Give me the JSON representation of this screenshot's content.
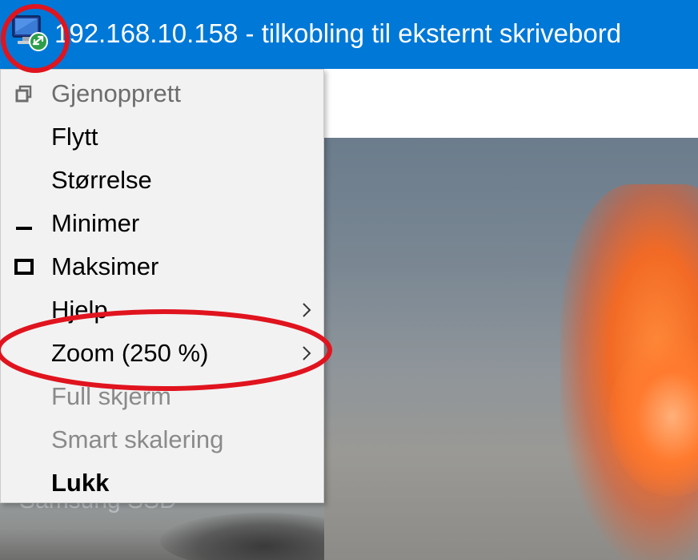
{
  "window": {
    "title": "192.168.10.158 - tilkobling til eksternt skrivebord",
    "icon": "remote-desktop-icon",
    "accent_color": "#0078d7"
  },
  "desktop": {
    "drive_label": "Samsung SSD"
  },
  "system_menu": {
    "items": [
      {
        "label": "Gjenopprett",
        "icon": "restore-icon",
        "state": "disabled"
      },
      {
        "label": "Flytt",
        "icon": "",
        "state": "enabled"
      },
      {
        "label": "Størrelse",
        "icon": "",
        "state": "enabled"
      },
      {
        "label": "Minimer",
        "icon": "minimize-icon",
        "state": "enabled"
      },
      {
        "label": "Maksimer",
        "icon": "maximize-icon",
        "state": "enabled"
      },
      {
        "label": "Hjelp",
        "icon": "",
        "state": "enabled",
        "submenu": true
      },
      {
        "label": "Zoom (250 %)",
        "icon": "",
        "state": "enabled",
        "submenu": true
      },
      {
        "label": "Full skjerm",
        "icon": "",
        "state": "disabled"
      },
      {
        "label": "Smart skalering",
        "icon": "",
        "state": "disabled"
      },
      {
        "label": "Lukk",
        "icon": "",
        "state": "default-bold"
      }
    ]
  },
  "annotations": {
    "color": "#e0141e"
  }
}
